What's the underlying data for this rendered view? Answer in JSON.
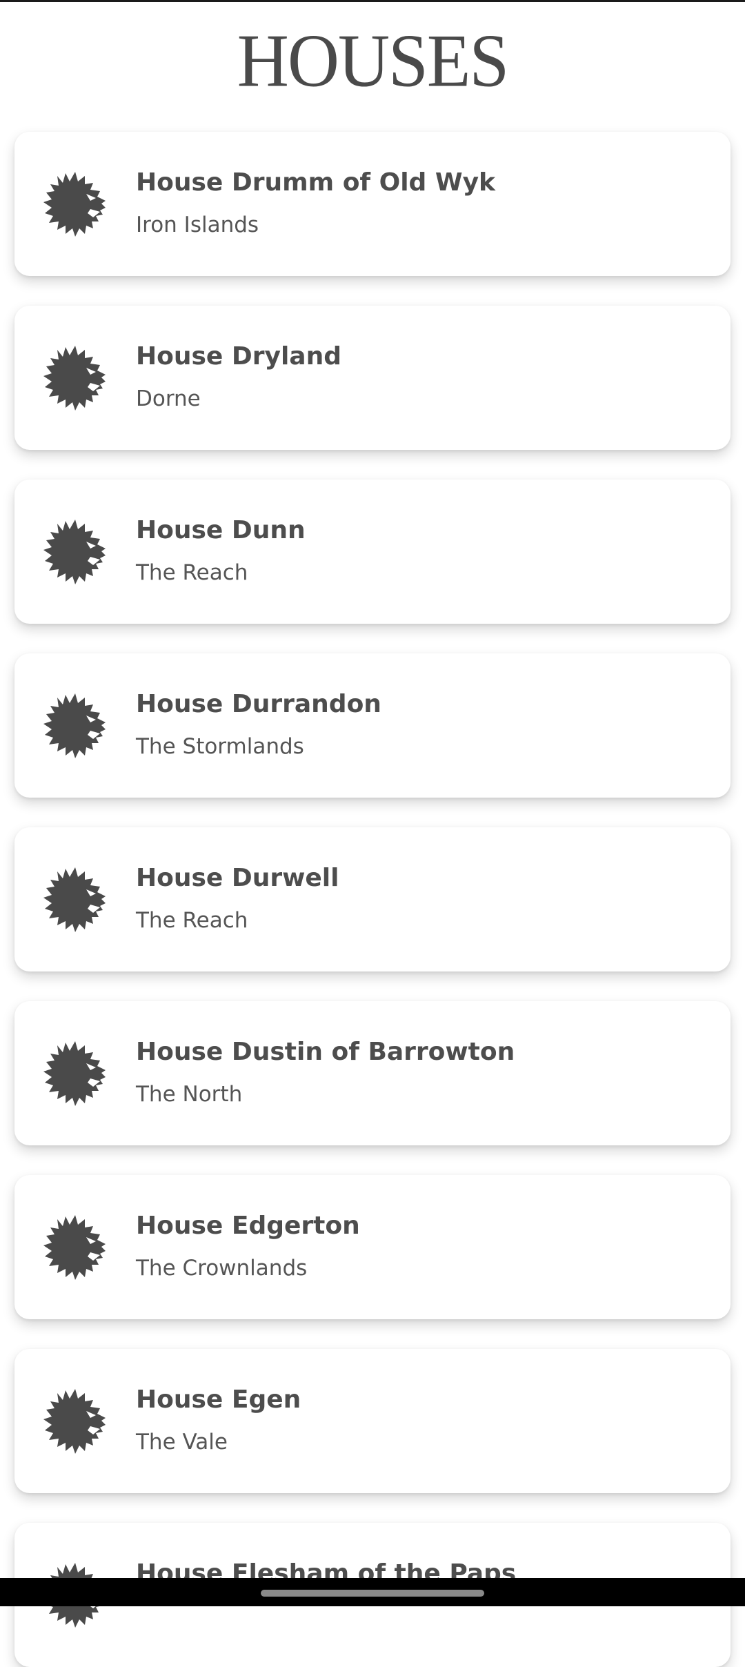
{
  "header": {
    "title": "HOUSES"
  },
  "houses": [
    {
      "name": "House Drumm of Old Wyk",
      "region": "Iron Islands",
      "sigil_icon": "lion-head-icon"
    },
    {
      "name": "House Dryland",
      "region": "Dorne",
      "sigil_icon": "lion-head-icon"
    },
    {
      "name": "House Dunn",
      "region": "The Reach",
      "sigil_icon": "lion-head-icon"
    },
    {
      "name": "House Durrandon",
      "region": "The Stormlands",
      "sigil_icon": "lion-head-icon"
    },
    {
      "name": "House Durwell",
      "region": "The Reach",
      "sigil_icon": "lion-head-icon"
    },
    {
      "name": "House Dustin of Barrowton",
      "region": "The North",
      "sigil_icon": "lion-head-icon"
    },
    {
      "name": "House Edgerton",
      "region": "The Crownlands",
      "sigil_icon": "lion-head-icon"
    },
    {
      "name": "House Egen",
      "region": "The Vale",
      "sigil_icon": "lion-head-icon"
    },
    {
      "name": "House Flesham of the Paps",
      "region": "",
      "sigil_icon": "lion-head-icon"
    }
  ],
  "colors": {
    "text": "#4a4a4a",
    "card_background": "#ffffff",
    "page_background": "#ffffff",
    "nav_bar": "#000000"
  }
}
